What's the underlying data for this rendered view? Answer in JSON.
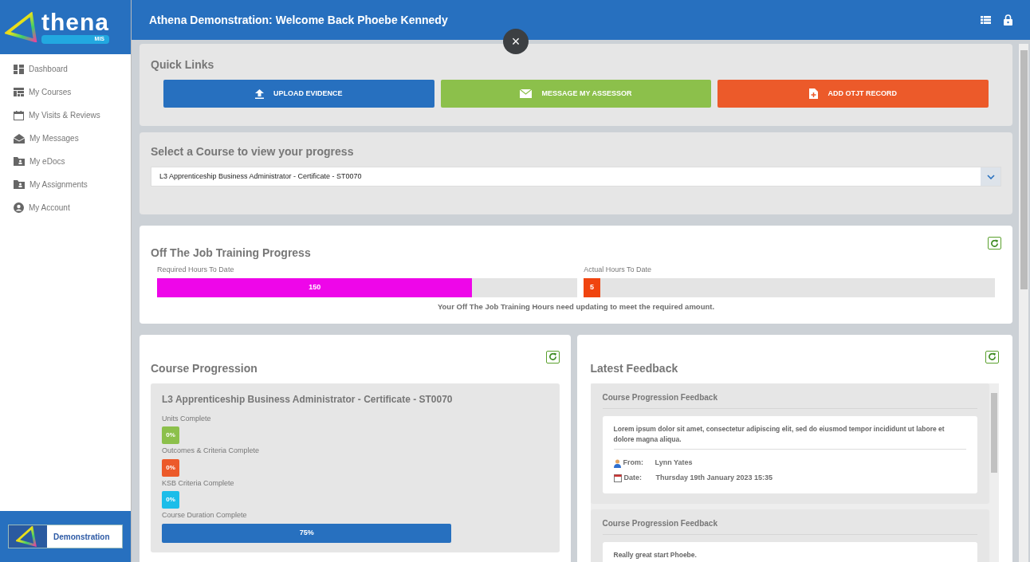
{
  "logo": {
    "text": "thena",
    "badge": "MIS"
  },
  "sidebar": {
    "items": [
      {
        "label": "Dashboard",
        "kind": "dashboard"
      },
      {
        "label": "My Courses",
        "kind": "courses"
      },
      {
        "label": "My Visits & Reviews",
        "kind": "calendar"
      },
      {
        "label": "My Messages",
        "kind": "envelope"
      },
      {
        "label": "My eDocs",
        "kind": "folder"
      },
      {
        "label": "My Assignments",
        "kind": "folder"
      },
      {
        "label": "My Account",
        "kind": "account"
      }
    ],
    "footer": {
      "label": "Demonstration"
    }
  },
  "header": {
    "title": "Athena Demonstration: Welcome Back Phoebe Kennedy",
    "close": "×"
  },
  "quick_links": {
    "title": "Quick Links",
    "buttons": [
      {
        "label": "UPLOAD EVIDENCE",
        "kind": "upload",
        "color": "#2770bf"
      },
      {
        "label": "MESSAGE MY ASSESSOR",
        "kind": "envelope",
        "color": "#8cc04b"
      },
      {
        "label": "ADD OTJT RECORD",
        "kind": "file",
        "color": "#ec5a2a"
      }
    ]
  },
  "course_select": {
    "title": "Select a Course to view your progress",
    "value": "L3 Apprenticeship Business Administrator - Certificate - ST0070"
  },
  "otjt": {
    "title": "Off The Job Training Progress",
    "bars": [
      {
        "label": "Required Hours To Date",
        "reading": "150",
        "level": 0.75,
        "color": "#ee06e9"
      },
      {
        "label": "Actual Hours To Date",
        "reading": "5",
        "level": 0.04,
        "color": "#f0440f"
      }
    ],
    "message": "Your Off The Job Training Hours need updating to meet the required amount."
  },
  "course_progression": {
    "title": "Course Progression",
    "course": "L3 Apprenticeship Business Administrator - Certificate - ST0070",
    "metrics": [
      {
        "label": "Units Complete",
        "kind": "badge",
        "value": "0%",
        "color": "#8cc04b"
      },
      {
        "label": "Outcomes & Criteria Complete",
        "kind": "badge",
        "value": "0%",
        "color": "#ec5a2a"
      },
      {
        "label": "KSB Criteria Complete",
        "kind": "badge",
        "value": "0%",
        "color": "#1bbde9"
      },
      {
        "label": "Course Duration Complete",
        "kind": "bar",
        "value": "75%",
        "level": 0.75,
        "color": "#2770bf"
      }
    ]
  },
  "latest_feedback": {
    "title": "Latest Feedback",
    "items": [
      {
        "title": "Course Progression Feedback",
        "body": "Lorem ipsum dolor sit amet, consectetur adipiscing elit, sed do eiusmod tempor incididunt ut labore et dolore magna aliqua.",
        "from_label": "From:",
        "from": "Lynn Yates",
        "date_label": "Date:",
        "date": "Thursday 19th January 2023 15:35"
      },
      {
        "title": "Course Progression Feedback",
        "body": "Really great start Phoebe."
      }
    ]
  }
}
